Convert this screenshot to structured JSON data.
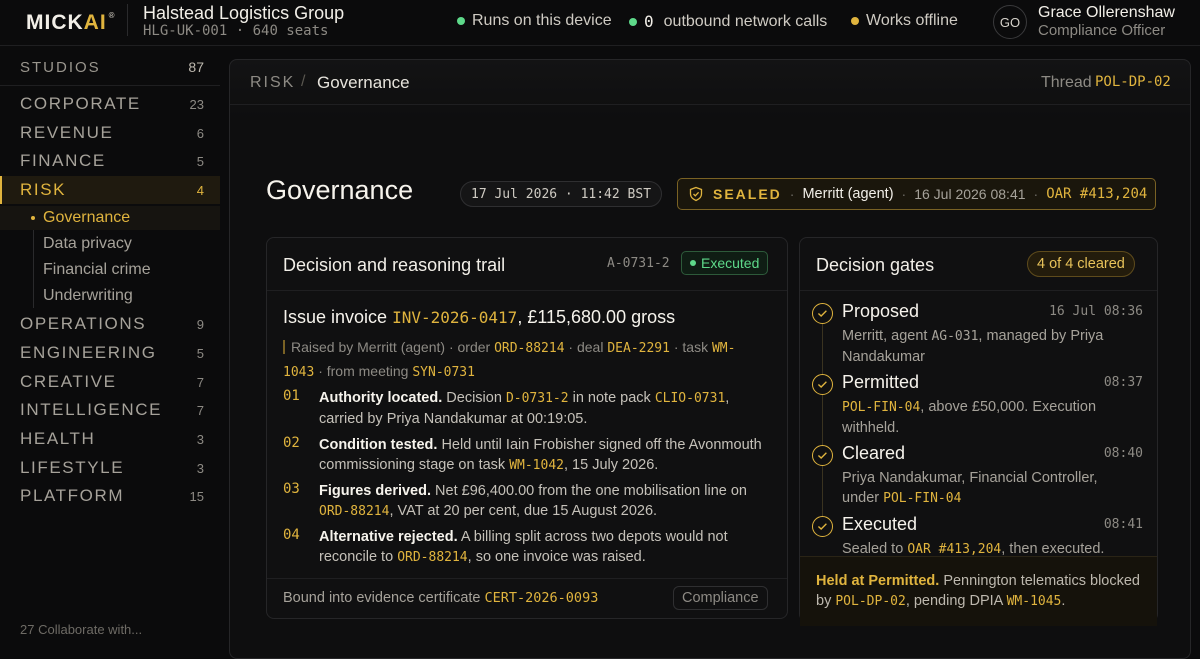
{
  "brand": {
    "prefix": "MICK",
    "accent": "AI",
    "mark": "®"
  },
  "org": {
    "name": "Halstead Logistics Group",
    "code": "HLG-UK-001",
    "seats": "640 seats"
  },
  "status": [
    {
      "label": "Runs on this device",
      "color": "#5ed98a"
    },
    {
      "count": "0",
      "label": "outbound network calls",
      "color": "#5ed98a"
    },
    {
      "label": "Works offline",
      "color": "#e0b43e"
    }
  ],
  "user": {
    "initials": "GO",
    "name": "Grace Ollerenshaw",
    "role": "Compliance Officer"
  },
  "sidebar": {
    "header": {
      "label": "STUDIOS",
      "count": "87"
    },
    "items": [
      {
        "label": "CORPORATE",
        "count": "23"
      },
      {
        "label": "REVENUE",
        "count": "6"
      },
      {
        "label": "FINANCE",
        "count": "5"
      },
      {
        "label": "RISK",
        "count": "4"
      },
      {
        "label": "OPERATIONS",
        "count": "9"
      },
      {
        "label": "ENGINEERING",
        "count": "5"
      },
      {
        "label": "CREATIVE",
        "count": "7"
      },
      {
        "label": "INTELLIGENCE",
        "count": "7"
      },
      {
        "label": "HEALTH",
        "count": "3"
      },
      {
        "label": "LIFESTYLE",
        "count": "3"
      },
      {
        "label": "PLATFORM",
        "count": "15"
      }
    ],
    "sub_items": [
      "Governance",
      "Data privacy",
      "Financial crime",
      "Underwriting"
    ],
    "footer": "27 Collaborate with..."
  },
  "breadcrumb": {
    "section": "RISK",
    "separator": "/",
    "current": "Governance"
  },
  "thread": {
    "label": "Thread",
    "value": "POL-DP-02"
  },
  "page": {
    "title": "Governance",
    "date": "17 Jul 2026",
    "time": "11:42 BST",
    "seal": {
      "status": "SEALED",
      "agent": "Merritt (agent)",
      "timestamp": "16 Jul 2026 08:41",
      "ref": "OAR #413,204"
    }
  },
  "trail": {
    "title": "Decision and reasoning trail",
    "id": "A-0731-2",
    "status": "Executed",
    "issue": {
      "prefix": "Issue invoice",
      "invoice": "INV-2026-0417",
      "amount": ", £115,680.00 gross"
    },
    "raised": {
      "t1": "Raised by Merritt (agent) · order",
      "order": "ORD-88214",
      "t2": "· deal",
      "deal": "DEA-2291",
      "t3": "· task",
      "task": "WM-1043",
      "t4": "· from meeting",
      "meeting": "SYN-0731"
    },
    "steps": [
      {
        "num": "01",
        "head": "Authority located.",
        "a": "Decision",
        "c1": "D-0731-2",
        "b": "in note pack",
        "c2": "CLIO-0731",
        "tail": ", carried by Priya Nandakumar at 00:19:05."
      },
      {
        "num": "02",
        "head": "Condition tested.",
        "a": "Held until Iain Frobisher signed off the Avonmouth commissioning stage on task",
        "c1": "WM-1042",
        "tail": ", 15 July 2026."
      },
      {
        "num": "03",
        "head": "Figures derived.",
        "a": "Net £96,400.00 from the one mobilisation line on",
        "c1": "ORD-88214",
        "tail": ", VAT at 20 per cent, due 15 August 2026."
      },
      {
        "num": "04",
        "head": "Alternative rejected.",
        "a": "A billing split across two depots would not reconcile to",
        "c1": "ORD-88214",
        "tail": ", so one invoice was raised."
      }
    ],
    "bound": {
      "label": "Bound into evidence certificate",
      "cert": "CERT-2026-0093"
    },
    "tag": "Compliance"
  },
  "gates": {
    "title": "Decision gates",
    "count": "4 of 4 cleared",
    "items": [
      {
        "name": "Proposed",
        "time": "16 Jul 08:36",
        "d1": "Merritt, agent",
        "code": "AG-031",
        "d2": ", managed by Priya Nandakumar"
      },
      {
        "name": "Permitted",
        "time": "08:37",
        "code": "POL-FIN-04",
        "d2": ", above £50,000. Execution withheld."
      },
      {
        "name": "Cleared",
        "time": "08:40",
        "d1": "Priya Nandakumar, Financial Controller, under",
        "code": "POL-FIN-04"
      },
      {
        "name": "Executed",
        "time": "08:41",
        "d1": "Sealed to",
        "code": "OAR #413,204",
        "d2": ", then executed."
      }
    ],
    "held": {
      "head": "Held at Permitted.",
      "a": "Pennington telematics blocked by",
      "c1": "POL-DP-02",
      "b": ", pending DPIA",
      "c2": "WM-1045",
      "tail": "."
    }
  },
  "colors": {
    "accent": "#e0b43e",
    "success": "#5ed98a",
    "background": "#0b0b0c"
  }
}
